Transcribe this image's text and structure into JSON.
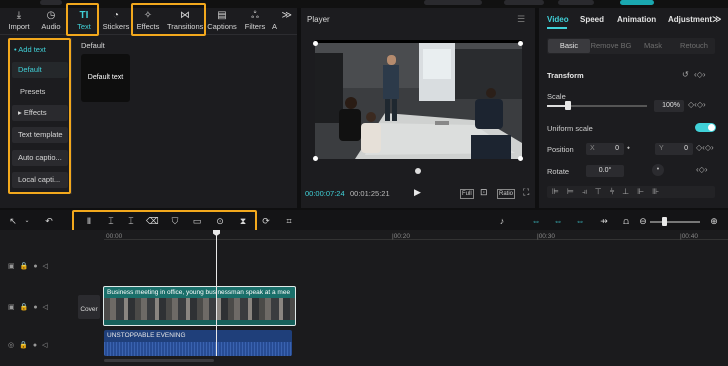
{
  "media_toolbar": {
    "items": [
      {
        "label": "Import",
        "icon": "import-icon",
        "glyph": "⤓"
      },
      {
        "label": "Audio",
        "icon": "audio-icon",
        "glyph": "◷"
      },
      {
        "label": "Text",
        "icon": "text-icon",
        "glyph": "TI"
      },
      {
        "label": "Stickers",
        "icon": "stickers-icon",
        "glyph": "◔"
      },
      {
        "label": "Effects",
        "icon": "effects-icon",
        "glyph": "✧"
      },
      {
        "label": "Transitions",
        "icon": "transitions-icon",
        "glyph": "⋈"
      },
      {
        "label": "Captions",
        "icon": "captions-icon",
        "glyph": "▤"
      },
      {
        "label": "Filters",
        "icon": "filters-icon",
        "glyph": "ஃ"
      },
      {
        "label": "A",
        "icon": "adjustment-icon",
        "glyph": "≫"
      }
    ],
    "active": "Text"
  },
  "text_sidebar": {
    "add_text": "• Add text",
    "default": "Default",
    "presets": "Presets",
    "effects": "▸ Effects",
    "text_template": "Text template",
    "auto_captions": "Auto captio...",
    "local_captions": "Local capti..."
  },
  "text_panel": {
    "section_title": "Default",
    "card_label": "Default text"
  },
  "player": {
    "title": "Player",
    "current_time": "00:00:07:24",
    "total_time": "00:01:25:21",
    "full_label": "Full",
    "ratio_label": "Ratio"
  },
  "properties": {
    "tabs": [
      "Video",
      "Speed",
      "Animation",
      "Adjustment"
    ],
    "active_tab": "Video",
    "subtabs": [
      "Basic",
      "Remove BG",
      "Mask",
      "Retouch"
    ],
    "transform_label": "Transform",
    "scale_label": "Scale",
    "scale_value": "100%",
    "uniform_scale_label": "Uniform scale",
    "position_label": "Position",
    "pos_x_label": "X",
    "pos_x_value": "0",
    "pos_y_label": "Y",
    "pos_y_value": "0",
    "rotate_label": "Rotate",
    "rotate_value": "0.0°",
    "uniform_scale_on": true
  },
  "timeline": {
    "ruler_labels": [
      "00:00",
      "|00:20",
      "|00:30",
      "|00:40"
    ],
    "video_clip_label": "Business meeting in office, young businessman speak at a mee",
    "cover_label": "Cover",
    "audio_clip_label": "UNSTOPPABLE EVENING"
  },
  "colors": {
    "accent": "#40d1d8",
    "highlight": "#f2a81d",
    "clip": "#1a6f6a",
    "audio_clip": "#1f3f7a"
  }
}
